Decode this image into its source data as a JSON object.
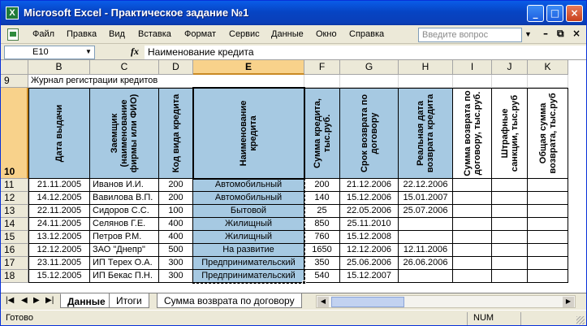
{
  "window": {
    "title": "Microsoft Excel - Практическое задание №1",
    "app_icon": "excel-icon",
    "controls": [
      "minimize-icon",
      "maximize-icon",
      "close-icon"
    ],
    "title_color": "#0a5de8"
  },
  "menu": {
    "items": [
      "Файл",
      "Правка",
      "Вид",
      "Вставка",
      "Формат",
      "Сервис",
      "Данные",
      "Окно",
      "Справка"
    ],
    "ask_placeholder": "Введите вопрос",
    "doc_controls": [
      "–",
      "⧉",
      "×"
    ]
  },
  "formula_bar": {
    "name_box": "E10",
    "fx_label": "fx",
    "formula": "Наименование кредита"
  },
  "sheet": {
    "columns": [
      "B",
      "C",
      "D",
      "E",
      "F",
      "G",
      "H",
      "I",
      "J",
      "K"
    ],
    "selected_column": "E",
    "row_numbers": [
      "9",
      "10",
      "11",
      "12",
      "13",
      "14",
      "15",
      "16",
      "17",
      "18"
    ],
    "selected_row": "10",
    "title": "Журнал регистрации кредитов",
    "headers": [
      "Дата выдачи",
      "Заемщик (наименование фирмы или ФИО)",
      "Код вида кредита",
      "Наименование кредита",
      "Сумма кредита, тыс.руб.",
      "Срок возврата по договору",
      "Реальная дата возврата кредита",
      "Сумма возврата по договору, тыс.руб.",
      "Штрафные санкции, тыс.руб",
      "Общая сумма возврата, тыс.руб"
    ],
    "rows": [
      [
        "21.11.2005",
        "Иванов И.И.",
        "200",
        "Автомобильный",
        "200",
        "21.12.2006",
        "22.12.2006",
        "",
        "",
        ""
      ],
      [
        "14.12.2005",
        "Вавилова В.П.",
        "200",
        "Автомобильный",
        "140",
        "15.12.2006",
        "15.01.2007",
        "",
        "",
        ""
      ],
      [
        "22.11.2005",
        "Сидоров С.С.",
        "100",
        "Бытовой",
        "25",
        "22.05.2006",
        "25.07.2006",
        "",
        "",
        ""
      ],
      [
        "24.11.2005",
        "Селянов Г.Е.",
        "400",
        "Жилищный",
        "850",
        "25.11.2010",
        "",
        "",
        "",
        ""
      ],
      [
        "13.12.2005",
        "Петров Р.М.",
        "400",
        "Жилищный",
        "760",
        "15.12.2008",
        "",
        "",
        "",
        ""
      ],
      [
        "12.12.2005",
        "ЗАО \"Днепр\"",
        "500",
        "На развитие",
        "1650",
        "12.12.2006",
        "12.11.2006",
        "",
        "",
        ""
      ],
      [
        "23.11.2005",
        "ИП Терех О.А.",
        "300",
        "Предпринимательский",
        "350",
        "25.06.2006",
        "26.06.2006",
        "",
        "",
        ""
      ],
      [
        "15.12.2005",
        "ИП Бекас П.Н.",
        "300",
        "Предпринимательский",
        "540",
        "15.12.2007",
        "",
        "",
        "",
        ""
      ]
    ],
    "highlight_color": "#a6c9e2"
  },
  "tabs": {
    "nav": [
      "|◀",
      "◀",
      "▶",
      "▶|"
    ],
    "items": [
      "Данные",
      "Итоги",
      "Сумма возврата по договору"
    ],
    "active": "Данные"
  },
  "status": {
    "text": "Готово",
    "num": "NUM"
  }
}
